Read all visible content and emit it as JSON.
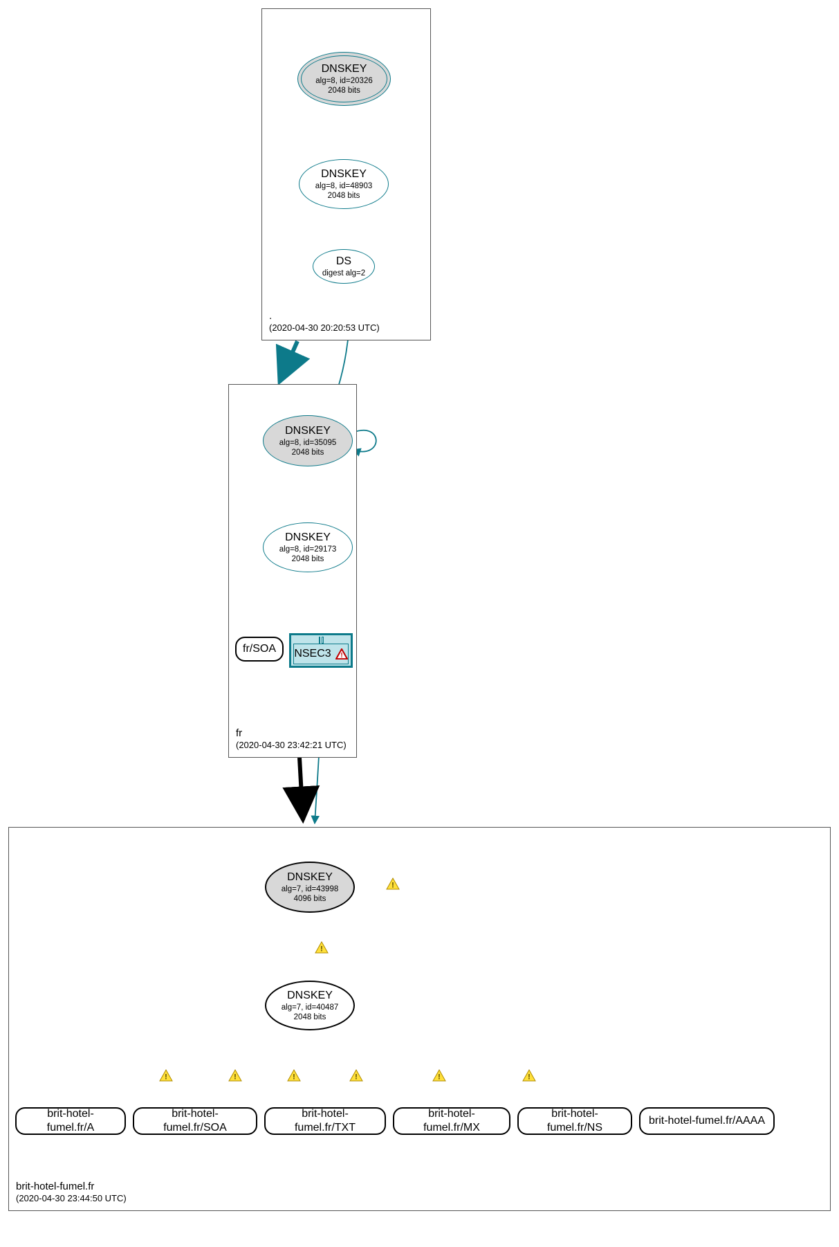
{
  "zones": {
    "root": {
      "name": ".",
      "timestamp": "(2020-04-30 20:20:53 UTC)"
    },
    "fr": {
      "name": "fr",
      "timestamp": "(2020-04-30 23:42:21 UTC)"
    },
    "leaf": {
      "name": "brit-hotel-fumel.fr",
      "timestamp": "(2020-04-30 23:44:50 UTC)"
    }
  },
  "nodes": {
    "root_ksk": {
      "title": "DNSKEY",
      "line2": "alg=8, id=20326",
      "line3": "2048 bits"
    },
    "root_zsk": {
      "title": "DNSKEY",
      "line2": "alg=8, id=48903",
      "line3": "2048 bits"
    },
    "root_ds": {
      "title": "DS",
      "line2": "digest alg=2"
    },
    "fr_ksk": {
      "title": "DNSKEY",
      "line2": "alg=8, id=35095",
      "line3": "2048 bits"
    },
    "fr_zsk": {
      "title": "DNSKEY",
      "line2": "alg=8, id=29173",
      "line3": "2048 bits"
    },
    "fr_soa": {
      "label": "fr/SOA"
    },
    "nsec3": {
      "label": "NSEC3"
    },
    "leaf_ksk": {
      "title": "DNSKEY",
      "line2": "alg=7, id=43998",
      "line3": "4096 bits"
    },
    "leaf_zsk": {
      "title": "DNSKEY",
      "line2": "alg=7, id=40487",
      "line3": "2048 bits"
    },
    "rr_a": {
      "label": "brit-hotel-fumel.fr/A"
    },
    "rr_soa": {
      "label": "brit-hotel-fumel.fr/SOA"
    },
    "rr_txt": {
      "label": "brit-hotel-fumel.fr/TXT"
    },
    "rr_mx": {
      "label": "brit-hotel-fumel.fr/MX"
    },
    "rr_ns": {
      "label": "brit-hotel-fumel.fr/NS"
    },
    "rr_aaaa": {
      "label": "brit-hotel-fumel.fr/AAAA"
    }
  },
  "colors": {
    "teal": "#0d7a8a",
    "black": "#000000"
  }
}
